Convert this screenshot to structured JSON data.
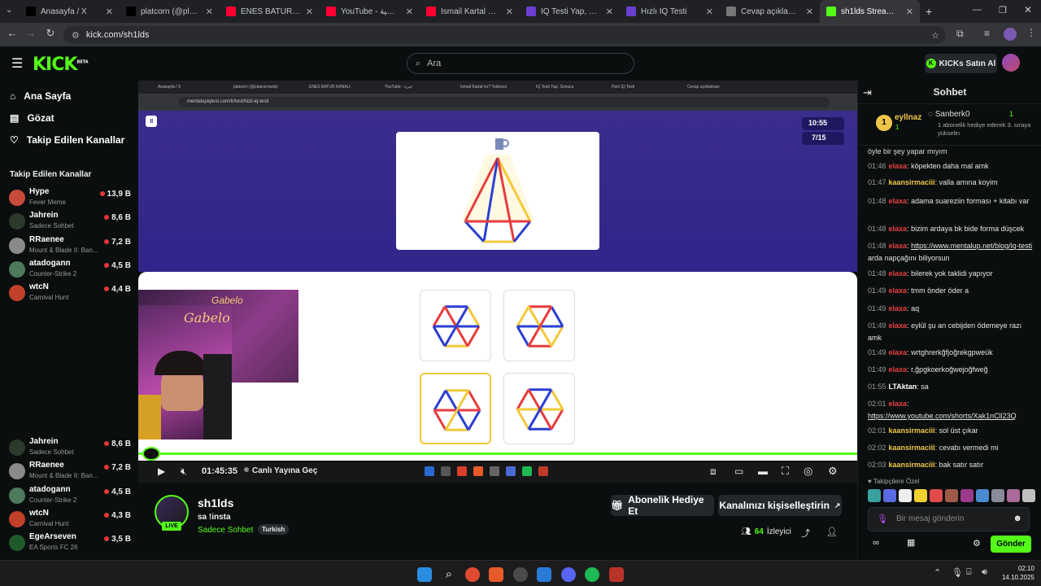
{
  "browser": {
    "tabs": [
      {
        "title": "Anasayfa / X",
        "icon": "x-icon"
      },
      {
        "title": "platcorn (@platcornweb)",
        "icon": "x-icon"
      },
      {
        "title": "ENES BATUR KANALI",
        "icon": "youtube-icon"
      },
      {
        "title": "YouTube - خيرة وطماطية",
        "icon": "youtube-icon"
      },
      {
        "title": "İsmail Kartal mı? Tedesco",
        "icon": "youtube-icon"
      },
      {
        "title": "IQ Testi Yap, Sonucu",
        "icon": "mentalup-icon"
      },
      {
        "title": "Hızlı IQ Testi",
        "icon": "mentalup-icon"
      },
      {
        "title": "Cevap açıklaması",
        "icon": "globe-icon"
      },
      {
        "title": "sh1lds Stream - Wat",
        "icon": "kick-icon"
      }
    ],
    "url": "kick.com/sh1lds"
  },
  "header": {
    "logo": "KICK",
    "logo_badge": "BETA",
    "search_placeholder": "Ara",
    "kicks_button": "KICKs Satın Al"
  },
  "sidebar": {
    "nav": [
      {
        "label": "Ana Sayfa",
        "icon": "home-icon"
      },
      {
        "label": "Gözat",
        "icon": "browse-icon"
      },
      {
        "label": "Takip Edilen Kanallar",
        "icon": "heart-icon"
      }
    ],
    "section_title": "Takip Edilen Kanallar",
    "channels_top": [
      {
        "name": "Hype",
        "game": "Fever Meme",
        "viewers": "13,9 B",
        "color": "#c84b3a"
      },
      {
        "name": "Jahrein",
        "game": "Sadece Sohbet",
        "viewers": "8,6 B",
        "color": "#2b3a2b"
      },
      {
        "name": "RRaenee",
        "game": "Mount & Blade II: Ban...",
        "viewers": "7,2 B",
        "color": "#8a8a8a"
      },
      {
        "name": "atadogann",
        "game": "Counter-Strike 2",
        "viewers": "4,5 B",
        "color": "#4d7a5a"
      },
      {
        "name": "wtcN",
        "game": "Carnival Hunt",
        "viewers": "4,4 B",
        "color": "#c0402a"
      }
    ],
    "channels_bottom": [
      {
        "name": "Jahrein",
        "game": "Sadece Sohbet",
        "viewers": "8,6 B",
        "color": "#2b3a2b"
      },
      {
        "name": "RRaenee",
        "game": "Mount & Blade II: Ban...",
        "viewers": "7,2 B",
        "color": "#8a8a8a"
      },
      {
        "name": "atadogann",
        "game": "Counter-Strike 2",
        "viewers": "4,5 B",
        "color": "#4d7a5a"
      },
      {
        "name": "wtcN",
        "game": "Carnival Hunt",
        "viewers": "4,3 B",
        "color": "#c0402a"
      },
      {
        "name": "EgeArseven",
        "game": "EA Sports FC 26",
        "viewers": "3,5 B",
        "color": "#1f5a2a"
      }
    ]
  },
  "video": {
    "inner_tabs": [
      "Anasayfa / X",
      "platcorn (@platcornweb)",
      "ENES BATUR KANALI",
      "YouTube - خيرة",
      "İsmail Kartal mı? Tedesco",
      "IQ Testi Yap, Sonucu",
      "Hızlı IQ Testi",
      "Cevap açıklaması"
    ],
    "inner_url": "mentalupiqtest.com/tr/test/hizli-iq-testi",
    "timer": "10:55",
    "progress": "7/15",
    "neon_sign": "Gabelo",
    "elapsed": "01:45:35",
    "live_button": "Canlı Yayına Geç"
  },
  "stream": {
    "channel": "sh1lds",
    "title": "sa !insta",
    "category": "Sadece Sohbet",
    "tag": "Turkish",
    "live_badge": "LIVE",
    "gift_button": "Abonelik Hediye Et",
    "customize_button": "Kanalınızı kişiselleştirin",
    "viewers": "64",
    "viewers_label": "İzleyici"
  },
  "chat": {
    "title": "Sohbet",
    "top_gifter": {
      "rank": "1",
      "name": "eyllnaz",
      "count": "1"
    },
    "second_gifter": {
      "name": "Sanberk0",
      "count": "1",
      "note": "1 abonelik hediye ederek 3. sıraya yükselin"
    },
    "partial_line": "öyle bir şey yapar mıyım",
    "messages": [
      {
        "time": "01:46",
        "user": "elaxa",
        "color": "#e84040",
        "text": "köpekten daha mal amk"
      },
      {
        "time": "01:47",
        "user": "kaansirmaciii",
        "color": "#f0c64a",
        "text": "valla amına koyim"
      },
      {
        "time": "01:48",
        "user": "elaxa",
        "color": "#e84040",
        "text": "adama suareziin forması + kitabı var"
      },
      {
        "time": "01:48",
        "user": "elaxa",
        "color": "#e84040",
        "text": "bizim ardaya bk bide forma düşcek"
      },
      {
        "time": "01:48",
        "user": "elaxa",
        "color": "#e84040",
        "text": "",
        "link": "https://www.mentalup.net/blog/iq-testi",
        "after": " arda napçağını biliyorsun"
      },
      {
        "time": "01:48",
        "user": "elaxa",
        "color": "#e84040",
        "text": "bilerek yok taklidi yapıyor"
      },
      {
        "time": "01:49",
        "user": "elaxa",
        "color": "#e84040",
        "text": "tmm önder öder a"
      },
      {
        "time": "01:49",
        "user": "elaxa",
        "color": "#e84040",
        "text": "aq"
      },
      {
        "time": "01:49",
        "user": "elaxa",
        "color": "#e84040",
        "text": "eylül şu an cebijden ödemeye razı amk"
      },
      {
        "time": "01:49",
        "user": "elaxa",
        "color": "#e84040",
        "text": "wrtghrerkğfjoğrekgpweük"
      },
      {
        "time": "01:49",
        "user": "elaxa",
        "color": "#e84040",
        "text": "r,ğpgkoerkoğwejoğfweğ"
      },
      {
        "time": "01:55",
        "user": "LTAktan",
        "color": "#ffffff",
        "text": "sa"
      },
      {
        "time": "02:01",
        "user": "elaxa",
        "color": "#e84040",
        "text": "",
        "link": "https://www.youtube.com/shorts/Xak1nCll23Q",
        "after": ""
      },
      {
        "time": "02:01",
        "user": "kaansirmaciii",
        "color": "#f0c64a",
        "text": "sol üst çıkar"
      },
      {
        "time": "02:02",
        "user": "kaansirmaciii",
        "color": "#f0c64a",
        "text": "cevabı vermedi mi"
      },
      {
        "time": "02:03",
        "user": "kaansirmaciii",
        "color": "#f0c64a",
        "text": "bak satır satır"
      }
    ],
    "emote_section": "Takipçilere Özel",
    "input_placeholder": "Bir mesaj gönderin",
    "send_button": "Gönder"
  },
  "taskbar": {
    "time": "02:10",
    "date": "14.10.2025"
  },
  "colors": {
    "kick_green": "#53fc18",
    "purple_bg": "#3a2d8c"
  }
}
